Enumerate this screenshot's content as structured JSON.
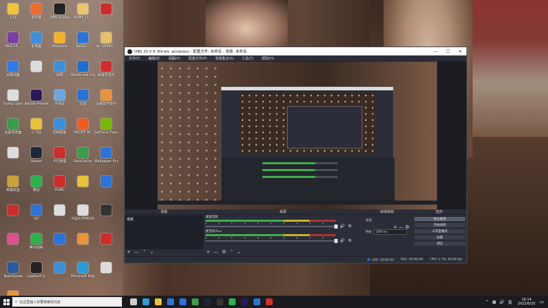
{
  "desktop": {
    "icons": [
      {
        "label": "123",
        "color": "#f0c53a"
      },
      {
        "label": "向日葵",
        "color": "#ef6b2c"
      },
      {
        "label": "OBS Studio",
        "color": "#222222"
      },
      {
        "label": "404M_Lo...",
        "color": "#e9c46a"
      },
      {
        "label": "",
        "color": "#cf2b2b"
      },
      {
        "label": "Bell 14...",
        "color": "#7a3fa0"
      },
      {
        "label": "此电脑",
        "color": "#3b8fd9"
      },
      {
        "label": "WeGame",
        "color": "#f0b429"
      },
      {
        "label": "BaiDu...",
        "color": "#2a73d8"
      },
      {
        "label": "dc_16493...",
        "color": "#e6c068"
      },
      {
        "label": "百度网盘",
        "color": "#2e7be6"
      },
      {
        "label": "",
        "color": "#dddddd"
      },
      {
        "label": "网络",
        "color": "#3b8fd9"
      },
      {
        "label": "Battle.net Lite",
        "color": "#1f6fd0"
      },
      {
        "label": "网易云音乐",
        "color": "#d42d2d"
      },
      {
        "label": "Dying Light",
        "color": "#dddddd"
      },
      {
        "label": "Adobe Premie...",
        "color": "#2b1a5a"
      },
      {
        "label": "回收站",
        "color": "#6da7e0"
      },
      {
        "label": "迅雷",
        "color": "#2a73d8"
      },
      {
        "label": "火绒安全软件",
        "color": "#e8943a"
      },
      {
        "label": "谷歌浏览器",
        "color": "#3a9e4a"
      },
      {
        "label": "小飞机",
        "color": "#e8c33a"
      },
      {
        "label": "控制面板",
        "color": "#3b8fd9"
      },
      {
        "label": "FACEIT AC",
        "color": "#f05a24"
      },
      {
        "label": "GeForce Experience",
        "color": "#76b900"
      },
      {
        "label": "",
        "color": "#dddddd"
      },
      {
        "label": "Steam",
        "color": "#1b2838"
      },
      {
        "label": "卡巴斯基",
        "color": "#cf2b2b"
      },
      {
        "label": "RainCache",
        "color": "#3a9e4a"
      },
      {
        "label": "Wallpaper Engine",
        "color": "#2a73d8"
      },
      {
        "label": "英雄联盟",
        "color": "#c9a33a"
      },
      {
        "label": "微信",
        "color": "#2bb24c"
      },
      {
        "label": "PUBG",
        "color": "#cf2b2b"
      },
      {
        "label": "",
        "color": "#e8c33a"
      },
      {
        "label": "",
        "color": "#2a73d8"
      },
      {
        "label": "",
        "color": "#cf2b2b"
      },
      {
        "label": "QQ",
        "color": "#2a73d8"
      },
      {
        "label": "",
        "color": "#dddddd"
      },
      {
        "label": "中国大学MOOC",
        "color": "#dddddd"
      },
      {
        "label": "",
        "color": "#333333"
      },
      {
        "label": "",
        "color": "#e04f8f"
      },
      {
        "label": "腾讯视频",
        "color": "#2bb24c"
      },
      {
        "label": "",
        "color": "#2a73d8"
      },
      {
        "label": "",
        "color": "#e8943a"
      },
      {
        "label": "",
        "color": "#cf2b2b"
      },
      {
        "label": "TeamSpeak",
        "color": "#2a5a9e"
      },
      {
        "label": "Logitech G",
        "color": "#222222"
      },
      {
        "label": "",
        "color": "#3b8fd9"
      },
      {
        "label": "Microsoft Edge",
        "color": "#2a9bd8"
      },
      {
        "label": "",
        "color": "#dddddd"
      },
      {
        "label": "",
        "color": "#e8943a"
      }
    ]
  },
  "obs": {
    "title": "OBS 25.0.8 (64-bit, windows) - 配置文件: 未命名 - 场景: 未命名",
    "window_controls": [
      "—",
      "☐",
      "✕"
    ],
    "menu": [
      "文件(F)",
      "编辑(E)",
      "视图(V)",
      "配置文件(P)",
      "场景集合(S)",
      "工具(T)",
      "帮助(H)"
    ],
    "panels": {
      "scenes_header": "场景",
      "sources_header": "来源",
      "mixer_header": "混音器",
      "transitions_header": "转场特效",
      "controls_header": "控件",
      "scene_item": "场景",
      "footer_scenes": [
        "+",
        "—",
        "⌃",
        "⌄"
      ],
      "footer_sources": [
        "+",
        "—",
        "⚙",
        "⌃",
        "⌄"
      ]
    },
    "mixer": {
      "tracks": [
        {
          "name": "桌面音频",
          "level": "0.0 dB"
        },
        {
          "name": "麦克风/Aux",
          "level": "0.0 dB"
        }
      ]
    },
    "transitions": {
      "type": "淡出",
      "duration_label": "时长",
      "duration_value": "300 ms"
    },
    "controls": {
      "buttons": [
        "停止推流",
        "开始录制",
        "工作室模式",
        "设置",
        "退出"
      ]
    },
    "status": {
      "live": "LIVE: 00:00:00",
      "rec": "REC: 00:00:00",
      "cpu": "CPU: 1.7%, 60.00 fps"
    }
  },
  "taskbar": {
    "search_placeholder": "在这里输入你要搜索的内容",
    "apps": [
      {
        "name": "task-view",
        "color": "#cfcfcf"
      },
      {
        "name": "edge",
        "color": "#2a9bd8"
      },
      {
        "name": "explorer",
        "color": "#e8c33a"
      },
      {
        "name": "store",
        "color": "#2a73d8"
      },
      {
        "name": "mail",
        "color": "#2a73d8"
      },
      {
        "name": "chrome",
        "color": "#3a9e4a"
      },
      {
        "name": "steam",
        "color": "#1b2838"
      },
      {
        "name": "obs",
        "color": "#333333"
      },
      {
        "name": "wechat",
        "color": "#2bb24c"
      },
      {
        "name": "pr",
        "color": "#2b1a5a"
      },
      {
        "name": "qq",
        "color": "#2a73d8"
      },
      {
        "name": "netease",
        "color": "#d42d2d"
      }
    ],
    "tray_lang": "英",
    "time": "16:14",
    "date": "2022/6/20"
  }
}
